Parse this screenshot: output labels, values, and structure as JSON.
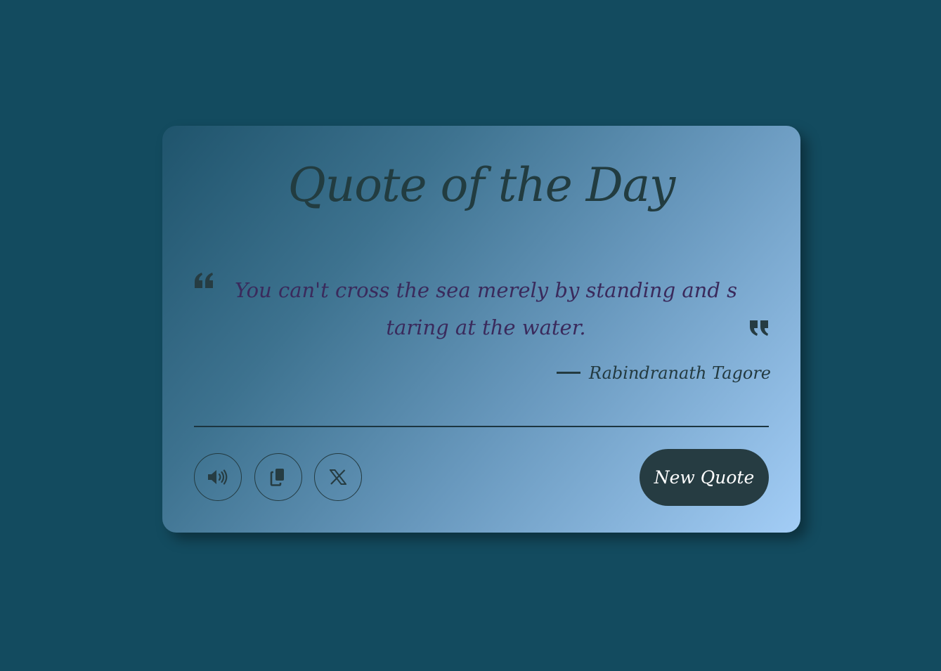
{
  "card": {
    "title": "Quote of the Day",
    "quote": "You can't cross the sea merely by standing and staring at the water.",
    "author": "Rabindranath Tagore"
  },
  "actions": {
    "speak_icon": "speaker-icon",
    "copy_icon": "copy-icon",
    "share_icon": "x-logo-icon",
    "new_quote_label": "New Quote"
  },
  "colors": {
    "background": "#134b5f",
    "gradient_start": "#1f546c",
    "gradient_end": "#a3cdf6",
    "title_text": "#223c40",
    "quote_text": "#3a2a5c",
    "button_bg": "#263c42",
    "button_text": "#ffffff"
  }
}
